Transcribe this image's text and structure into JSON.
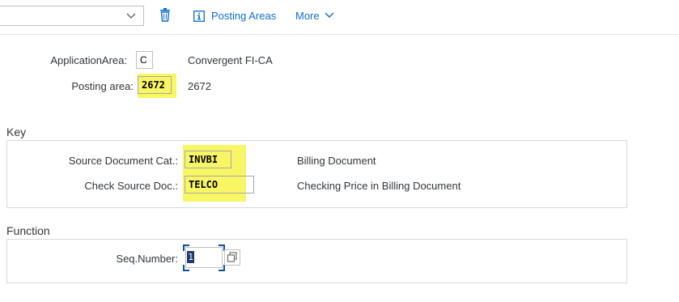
{
  "toolbar": {
    "dropdown_value": "",
    "posting_areas_label": "Posting Areas",
    "more_label": "More"
  },
  "header_fields": {
    "application_area": {
      "label": "ApplicationArea:",
      "value": "C",
      "description": "Convergent FI-CA"
    },
    "posting_area": {
      "label": "Posting area:",
      "value": "2672",
      "description": "2672"
    }
  },
  "key_section": {
    "title": "Key",
    "source_doc_cat": {
      "label": "Source Document Cat.:",
      "value": "INVBI",
      "description": "Billing Document"
    },
    "check_source_doc": {
      "label": "Check Source Doc.:",
      "value": "TELCO",
      "description": "Checking Price in Billing Document"
    }
  },
  "function_section": {
    "title": "Function",
    "seq_number": {
      "label": "Seq.Number:",
      "value": "1"
    }
  },
  "colors": {
    "highlight": "#f8f44a",
    "link": "#0a6ed1",
    "focus": "#0854a0"
  },
  "icons": {
    "dropdown": "chevron-down-icon",
    "delete": "trash-icon",
    "posting_areas": "info-icon",
    "more": "chevron-down-icon",
    "value_help": "value-help-icon"
  }
}
